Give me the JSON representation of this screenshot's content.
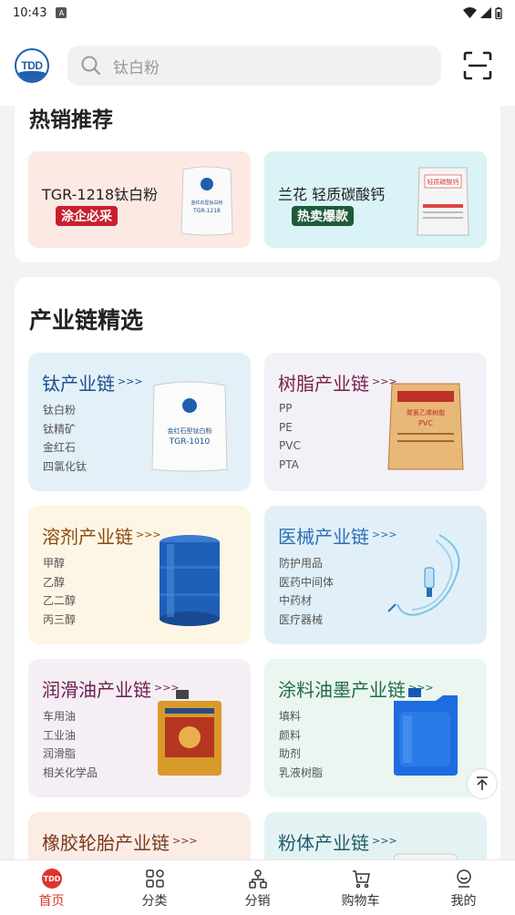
{
  "status_bar": {
    "time": "10:43",
    "notif": "A"
  },
  "header": {
    "logo_text": "TDD",
    "search_placeholder": "钛白粉"
  },
  "hot": {
    "title": "热销推荐",
    "items": [
      {
        "name": "TGR-1218钛白粉",
        "tag": "涂企必采",
        "tag_color": "#c8202e",
        "bg": "#fde9e3"
      },
      {
        "name": "兰花 轻质碳酸钙",
        "tag": "热卖爆款",
        "tag_color": "#1f5a3a",
        "bg": "#d9f3f6"
      }
    ]
  },
  "chain": {
    "title": "产业链精选",
    "more": ">>>",
    "tiles": [
      {
        "name": "钛产业链",
        "items": [
          "钛白粉",
          "钛精矿",
          "金红石",
          "四氯化钛"
        ],
        "color": "#1f4e8c",
        "bg": "#e3f0f8"
      },
      {
        "name": "树脂产业链",
        "items": [
          "PP",
          "PE",
          "PVC",
          "PTA"
        ],
        "color": "#7a1f4a",
        "bg": "#f3f1f8"
      },
      {
        "name": "溶剂产业链",
        "items": [
          "甲醇",
          "乙醇",
          "乙二醇",
          "丙三醇"
        ],
        "color": "#8a4a10",
        "bg": "#fdf6e4"
      },
      {
        "name": "医械产业链",
        "items": [
          "防护用品",
          "医药中间体",
          "中药材",
          "医疗器械"
        ],
        "color": "#2a6fb4",
        "bg": "#e1f0f8"
      },
      {
        "name": "润滑油产业链",
        "items": [
          "车用油",
          "工业油",
          "润滑脂",
          "相关化学品"
        ],
        "color": "#6a1f4e",
        "bg": "#f5eef5"
      },
      {
        "name": "涂料油墨产业链",
        "items": [
          "填料",
          "颜料",
          "助剂",
          "乳液树脂"
        ],
        "color": "#1f6a4a",
        "bg": "#eaf6ef"
      },
      {
        "name": "橡胶轮胎产业链",
        "items": [],
        "color": "#7a3a1a",
        "bg": "#fbece6"
      },
      {
        "name": "粉体产业链",
        "items": [],
        "color": "#1f5a6a",
        "bg": "#e3f3f4"
      }
    ]
  },
  "product_labels": {
    "tgr1218": "TGR-1218",
    "tgr1010": "TGR-1010",
    "tgr_brand": "金红石型钛白粉",
    "caco3": "轻质碳酸钙",
    "pvc": "PVC",
    "pvc_brand": "聚氯乙烯树脂"
  },
  "tabbar": [
    {
      "label": "首页",
      "icon": "home-logo-icon",
      "active": true
    },
    {
      "label": "分类",
      "icon": "grid-icon",
      "active": false
    },
    {
      "label": "分销",
      "icon": "share-nodes-icon",
      "active": false
    },
    {
      "label": "购物车",
      "icon": "cart-icon",
      "active": false
    },
    {
      "label": "我的",
      "icon": "user-icon",
      "active": false
    }
  ]
}
